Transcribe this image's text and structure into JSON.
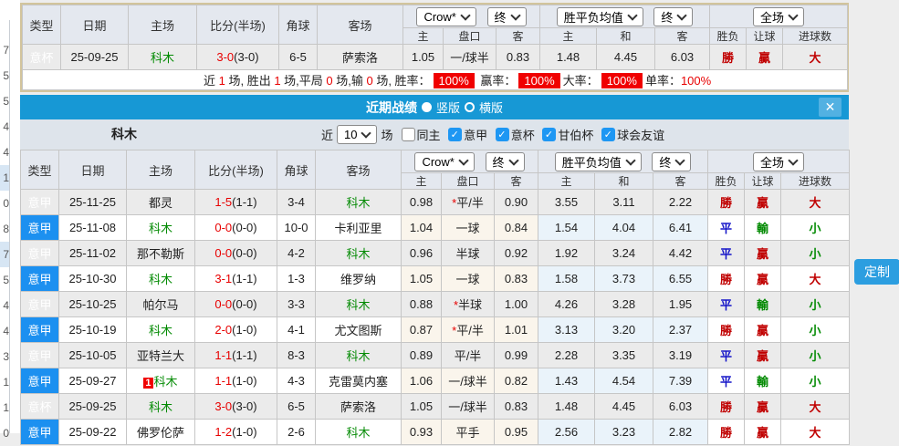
{
  "strip": {
    "digits": [
      {
        "d": "7",
        "hl": ""
      },
      {
        "d": "5",
        "hl": ""
      },
      {
        "d": "5",
        "hl": ""
      },
      {
        "d": "4",
        "hl": ""
      },
      {
        "d": "4",
        "hl": ""
      },
      {
        "d": "1",
        "hl": "hl"
      },
      {
        "d": "0",
        "hl": ""
      },
      {
        "d": "8",
        "hl": ""
      },
      {
        "d": "7",
        "hl": "hl"
      },
      {
        "d": "5",
        "hl": ""
      },
      {
        "d": "4",
        "hl": ""
      },
      {
        "d": "4",
        "hl": ""
      },
      {
        "d": "3",
        "hl": ""
      },
      {
        "d": "1",
        "hl": ""
      },
      {
        "d": "1",
        "hl": ""
      },
      {
        "d": "0",
        "hl": ""
      }
    ]
  },
  "columns": {
    "type": "类型",
    "date": "日期",
    "home": "主场",
    "score": "比分(半场)",
    "corner": "角球",
    "away": "客场",
    "h": "主",
    "pan": "盘口",
    "a": "客",
    "m_h": "主",
    "m_d": "和",
    "m_a": "客",
    "res": "胜负",
    "handicap": "让球",
    "goals": "进球数"
  },
  "selects": {
    "company": "Crow*",
    "final": "终",
    "mean": "胜平负均值",
    "scope": "全场"
  },
  "summary": {
    "rows": [
      {
        "type": "意杯",
        "tcls": "bei",
        "date": "25-09-25",
        "home": "科木",
        "hcls": "grn",
        "hbadge": "",
        "score": "3-0",
        "half": "(3-0)",
        "corner": "6-5",
        "away": "萨索洛",
        "acls": "",
        "o1": "1.05",
        "star": "",
        "pan": "一/球半",
        "o2": "0.83",
        "m1": "1.48",
        "m2": "4.45",
        "m3": "6.03",
        "r1": "勝",
        "c1": "rd",
        "r2": "贏",
        "c2": "rd",
        "r3": "大",
        "c3": "rd"
      }
    ],
    "stats": [
      {
        "t": "近 ",
        "c": ""
      },
      {
        "t": "1",
        "c": "n"
      },
      {
        "t": " 场, 胜出 ",
        "c": ""
      },
      {
        "t": "1",
        "c": "n"
      },
      {
        "t": " 场,平局 ",
        "c": ""
      },
      {
        "t": "0",
        "c": "n"
      },
      {
        "t": " 场,输 ",
        "c": ""
      },
      {
        "t": "0",
        "c": "n"
      },
      {
        "t": " 场, 胜率：",
        "c": ""
      },
      {
        "t": "100%",
        "c": "bdg"
      },
      {
        "t": " 赢率：",
        "c": ""
      },
      {
        "t": "100%",
        "c": "bdg"
      },
      {
        "t": "大率：",
        "c": ""
      },
      {
        "t": "100%",
        "c": "bdg"
      },
      {
        "t": "单率：",
        "c": ""
      },
      {
        "t": "100%",
        "c": "n"
      }
    ]
  },
  "overlay": {
    "title": "近期战绩",
    "radio_vertical": "竖版",
    "radio_horizontal": "横版",
    "close_icon": "✕",
    "team": "科木",
    "near_label": "近",
    "match_count": "10",
    "games_label": "场",
    "filters": [
      {
        "label": "同主",
        "state": "off"
      },
      {
        "label": "意甲",
        "state": "on"
      },
      {
        "label": "意杯",
        "state": "on"
      },
      {
        "label": "甘伯杯",
        "state": "on"
      },
      {
        "label": "球会友谊",
        "state": "on"
      }
    ]
  },
  "history": {
    "rows": [
      {
        "type": "意甲",
        "tcls": "jia",
        "date": "25-11-25",
        "home": "都灵",
        "hcls": "",
        "hbadge": "",
        "score": "1-5",
        "half": "(1-1)",
        "corner": "3-4",
        "away": "科木",
        "acls": "grn",
        "o1": "0.98",
        "star": "*",
        "pan": "平/半",
        "o2": "0.90",
        "m1": "3.55",
        "m2": "3.11",
        "m3": "2.22",
        "r1": "勝",
        "c1": "rd",
        "r2": "贏",
        "c2": "rd",
        "r3": "大",
        "c3": "rd"
      },
      {
        "type": "意甲",
        "tcls": "jia",
        "date": "25-11-08",
        "home": "科木",
        "hcls": "grn",
        "hbadge": "",
        "score": "0-0",
        "half": "(0-0)",
        "corner": "10-0",
        "away": "卡利亚里",
        "acls": "",
        "o1": "1.04",
        "star": "",
        "pan": "一球",
        "o2": "0.84",
        "m1": "1.54",
        "m2": "4.04",
        "m3": "6.41",
        "r1": "平",
        "c1": "bl",
        "r2": "輸",
        "c2": "gn",
        "r3": "小",
        "c3": "gn"
      },
      {
        "type": "意甲",
        "tcls": "jia",
        "date": "25-11-02",
        "home": "那不勒斯",
        "hcls": "",
        "hbadge": "",
        "score": "0-0",
        "half": "(0-0)",
        "corner": "4-2",
        "away": "科木",
        "acls": "grn",
        "o1": "0.96",
        "star": "",
        "pan": "半球",
        "o2": "0.92",
        "m1": "1.92",
        "m2": "3.24",
        "m3": "4.42",
        "r1": "平",
        "c1": "bl",
        "r2": "贏",
        "c2": "rd",
        "r3": "小",
        "c3": "gn"
      },
      {
        "type": "意甲",
        "tcls": "jia",
        "date": "25-10-30",
        "home": "科木",
        "hcls": "grn",
        "hbadge": "",
        "score": "3-1",
        "half": "(1-1)",
        "corner": "1-3",
        "away": "维罗纳",
        "acls": "",
        "o1": "1.05",
        "star": "",
        "pan": "一球",
        "o2": "0.83",
        "m1": "1.58",
        "m2": "3.73",
        "m3": "6.55",
        "r1": "勝",
        "c1": "rd",
        "r2": "贏",
        "c2": "rd",
        "r3": "大",
        "c3": "rd"
      },
      {
        "type": "意甲",
        "tcls": "jia",
        "date": "25-10-25",
        "home": "帕尔马",
        "hcls": "",
        "hbadge": "",
        "score": "0-0",
        "half": "(0-0)",
        "corner": "3-3",
        "away": "科木",
        "acls": "grn",
        "o1": "0.88",
        "star": "*",
        "pan": "半球",
        "o2": "1.00",
        "m1": "4.26",
        "m2": "3.28",
        "m3": "1.95",
        "r1": "平",
        "c1": "bl",
        "r2": "輸",
        "c2": "gn",
        "r3": "小",
        "c3": "gn"
      },
      {
        "type": "意甲",
        "tcls": "jia",
        "date": "25-10-19",
        "home": "科木",
        "hcls": "grn",
        "hbadge": "",
        "score": "2-0",
        "half": "(1-0)",
        "corner": "4-1",
        "away": "尤文图斯",
        "acls": "",
        "o1": "0.87",
        "star": "*",
        "pan": "平/半",
        "o2": "1.01",
        "m1": "3.13",
        "m2": "3.20",
        "m3": "2.37",
        "r1": "勝",
        "c1": "rd",
        "r2": "贏",
        "c2": "rd",
        "r3": "小",
        "c3": "gn"
      },
      {
        "type": "意甲",
        "tcls": "jia",
        "date": "25-10-05",
        "home": "亚特兰大",
        "hcls": "",
        "hbadge": "",
        "score": "1-1",
        "half": "(1-1)",
        "corner": "8-3",
        "away": "科木",
        "acls": "grn",
        "o1": "0.89",
        "star": "",
        "pan": "平/半",
        "o2": "0.99",
        "m1": "2.28",
        "m2": "3.35",
        "m3": "3.19",
        "r1": "平",
        "c1": "bl",
        "r2": "贏",
        "c2": "rd",
        "r3": "小",
        "c3": "gn"
      },
      {
        "type": "意甲",
        "tcls": "jia",
        "date": "25-09-27",
        "home": "科木",
        "hcls": "grn",
        "hbadge": "1",
        "score": "1-1",
        "half": "(1-0)",
        "corner": "4-3",
        "away": "克雷莫内塞",
        "acls": "",
        "o1": "1.06",
        "star": "",
        "pan": "一/球半",
        "o2": "0.82",
        "m1": "1.43",
        "m2": "4.54",
        "m3": "7.39",
        "r1": "平",
        "c1": "bl",
        "r2": "輸",
        "c2": "gn",
        "r3": "小",
        "c3": "gn"
      },
      {
        "type": "意杯",
        "tcls": "bei",
        "date": "25-09-25",
        "home": "科木",
        "hcls": "grn",
        "hbadge": "",
        "score": "3-0",
        "half": "(3-0)",
        "corner": "6-5",
        "away": "萨索洛",
        "acls": "",
        "o1": "1.05",
        "star": "",
        "pan": "一/球半",
        "o2": "0.83",
        "m1": "1.48",
        "m2": "4.45",
        "m3": "6.03",
        "r1": "勝",
        "c1": "rd",
        "r2": "贏",
        "c2": "rd",
        "r3": "大",
        "c3": "rd"
      },
      {
        "type": "意甲",
        "tcls": "jia",
        "date": "25-09-22",
        "home": "佛罗伦萨",
        "hcls": "",
        "hbadge": "",
        "score": "1-2",
        "half": "(1-0)",
        "corner": "2-6",
        "away": "科木",
        "acls": "grn",
        "o1": "0.93",
        "star": "",
        "pan": "平手",
        "o2": "0.95",
        "m1": "2.56",
        "m2": "3.23",
        "m3": "2.82",
        "r1": "勝",
        "c1": "rd",
        "r2": "贏",
        "c2": "rd",
        "r3": "大",
        "c3": "rd"
      }
    ]
  },
  "custom_button": "定制",
  "colors": {
    "league_serie_a": "#1C90F0",
    "league_cup": "#4141F0",
    "title_bar": "#1798D5",
    "win_red": "#C00000",
    "draw_blue": "#1414C8",
    "lose_green": "#028A02",
    "odds_bg": "#FAF5EC",
    "mean_bg": "#EAF3FA",
    "badge_red": "#F00000",
    "button_blue": "#2C9EE0"
  }
}
